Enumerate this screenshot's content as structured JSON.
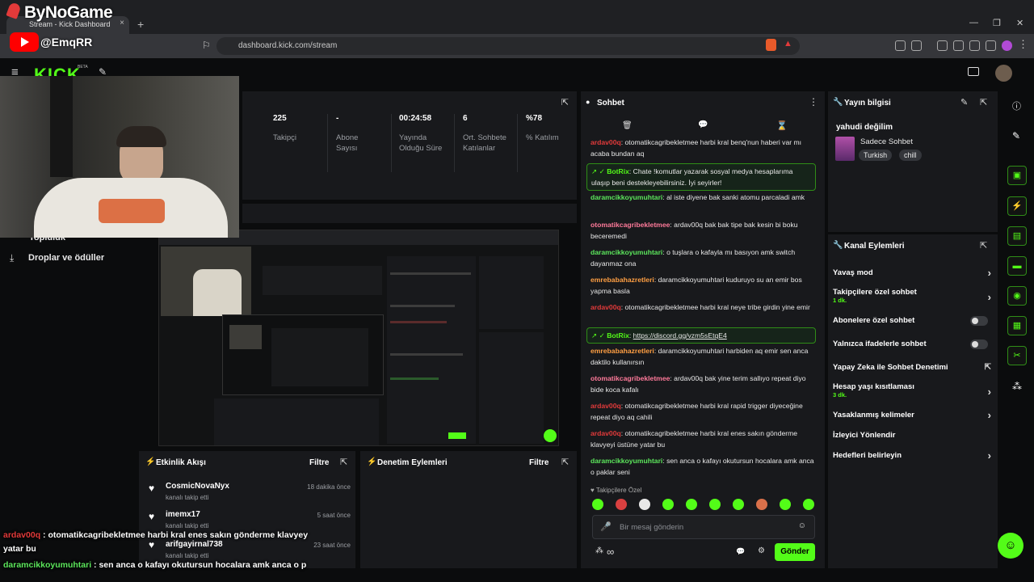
{
  "brand": {
    "name": "ByNoGame",
    "youtube_handle": "EmqRR"
  },
  "browser": {
    "tab_title": "Stream - Kick Dashboard",
    "url": "dashboard.kick.com/stream",
    "new_tab": "+",
    "close": "×"
  },
  "kick": {
    "logo": "KICK",
    "beta": "BETA"
  },
  "stats": [
    {
      "value": "225",
      "label": "Takipçi"
    },
    {
      "value": "-",
      "label": "Abone Sayısı"
    },
    {
      "value": "00:24:58",
      "label": "Yayında Olduğu Süre"
    },
    {
      "value": "6",
      "label": "Ort. Sohbete Katılanlar"
    },
    {
      "value": "%78",
      "label": "% Katılım"
    }
  ],
  "sidebar": {
    "item_partial": "Topluluk",
    "drops": "Droplar ve ödüller"
  },
  "activity": {
    "title": "Etkinlik Akışı",
    "filter": "Filtre",
    "events": [
      {
        "user": "CosmicNovaNyx",
        "action": "kanalı takip etti",
        "time": "18 dakika önce"
      },
      {
        "user": "imemx17",
        "action": "kanalı takip etti",
        "time": "5 saat önce"
      },
      {
        "user": "arifgayirnal738",
        "action": "kanalı takip etti",
        "time": "23 saat önce"
      }
    ]
  },
  "moderation": {
    "title": "Denetim Eylemleri",
    "filter": "Filtre"
  },
  "chat": {
    "title": "Sohbet",
    "messages": [
      {
        "user": "ardav00q",
        "color": "#e23a3a",
        "text": "otomatikcagribekletmee harbi kral benq'nun haberi var mı acaba bundan aq"
      },
      {
        "user": "BotRix",
        "color": "#53fc18",
        "bot": true,
        "text": "Chate !komutlar yazarak sosyal medya hesaplarıma ulaşıp beni destekleyebilirsiniz. İyi seyirler!"
      },
      {
        "user": "daramcikkoyumuhtari",
        "color": "#5ce65c",
        "text": "al iste diyene bak sanki atomu parcaladi amk"
      },
      {
        "user": "otomatikcagribekletmee",
        "color": "#ff7a9a",
        "text": "ardav00q bak bak tipe bak kesin bi boku beceremedi"
      },
      {
        "user": "daramcikkoyumuhtari",
        "color": "#5ce65c",
        "text": "o tuşlara o kafayla mı basıyon amk switch dayanmaz ona"
      },
      {
        "user": "emrebabahazretleri",
        "color": "#ff9f43",
        "text": "daramcikkoyumuhtari kuduruyo su an emir bos yapma basla"
      },
      {
        "user": "ardav00q",
        "color": "#e23a3a",
        "text": "otomatikcagribekletmee harbi kral neye tribe girdin yine emir"
      },
      {
        "user": "BotRix",
        "color": "#53fc18",
        "bot": true,
        "text": "https://discord.gg/vzm5sEtqE4"
      },
      {
        "user": "emrebabahazretleri",
        "color": "#ff9f43",
        "text": "daramcikkoyumuhtari harbiden aq emir sen anca daktilo kullanırsın"
      },
      {
        "user": "otomatikcagribekletmee",
        "color": "#ff7a9a",
        "text": "ardav00q bak yine terim sallıyo repeat diyo bide koca kafalı"
      },
      {
        "user": "ardav00q",
        "color": "#e23a3a",
        "text": "otomatikcagribekletmee harbi kral rapid trigger diyeceğine repeat diyo aq cahili"
      },
      {
        "user": "ardav00q",
        "color": "#e23a3a",
        "text": "otomatikcagribekletmee harbi kral enes sakın gönderme klavyeyi üstüne yatar bu"
      },
      {
        "user": "daramcikkoyumuhtari",
        "color": "#5ce65c",
        "text": "sen anca o kafayı okutursun hocalara amk anca o paklar seni"
      }
    ],
    "followers_only": "Takipçilere Özel",
    "input_placeholder": "Bir mesaj gönderin",
    "send": "Gönder",
    "infinity": "∞"
  },
  "stream_info": {
    "title": "Yayın bilgisi",
    "stream_title": "yahudi değilim",
    "category": "Sadece Sohbet",
    "tags": [
      "Turkish",
      "chill"
    ]
  },
  "channel_actions": {
    "title": "Kanal Eylemleri",
    "items": [
      {
        "label": "Yavaş mod",
        "sub": ""
      },
      {
        "label": "Takipçilere özel sohbet",
        "sub": "1 dk."
      },
      {
        "label": "Abonelere özel sohbet",
        "sub": ""
      },
      {
        "label": "Yalnızca ifadelerle sohbet",
        "sub": ""
      },
      {
        "label": "Yapay Zeka ile Sohbet Denetimi",
        "sub": ""
      },
      {
        "label": "Hesap yaşı kısıtlaması",
        "sub": "3 dk."
      },
      {
        "label": "Yasaklanmış kelimeler",
        "sub": ""
      },
      {
        "label": "İzleyici Yönlendir",
        "sub": ""
      },
      {
        "label": "Hedefleri belirleyin",
        "sub": ""
      }
    ]
  },
  "overlay_chat": [
    {
      "user": "ardav00q",
      "color": "#e23a3a",
      "text": "otomatikcagribekletmee harbi kral enes sakın gönderme klavyey"
    },
    {
      "user": "",
      "color": "#ffffff",
      "text": "yatar bu"
    },
    {
      "user": "daramcikkoyumuhtari",
      "color": "#5ce65c",
      "text": "sen anca o kafayı okutursun hocalara amk anca o p"
    }
  ],
  "colors": {
    "accent": "#53fc18",
    "panel": "#18191c",
    "background": "#0b0c0d"
  }
}
